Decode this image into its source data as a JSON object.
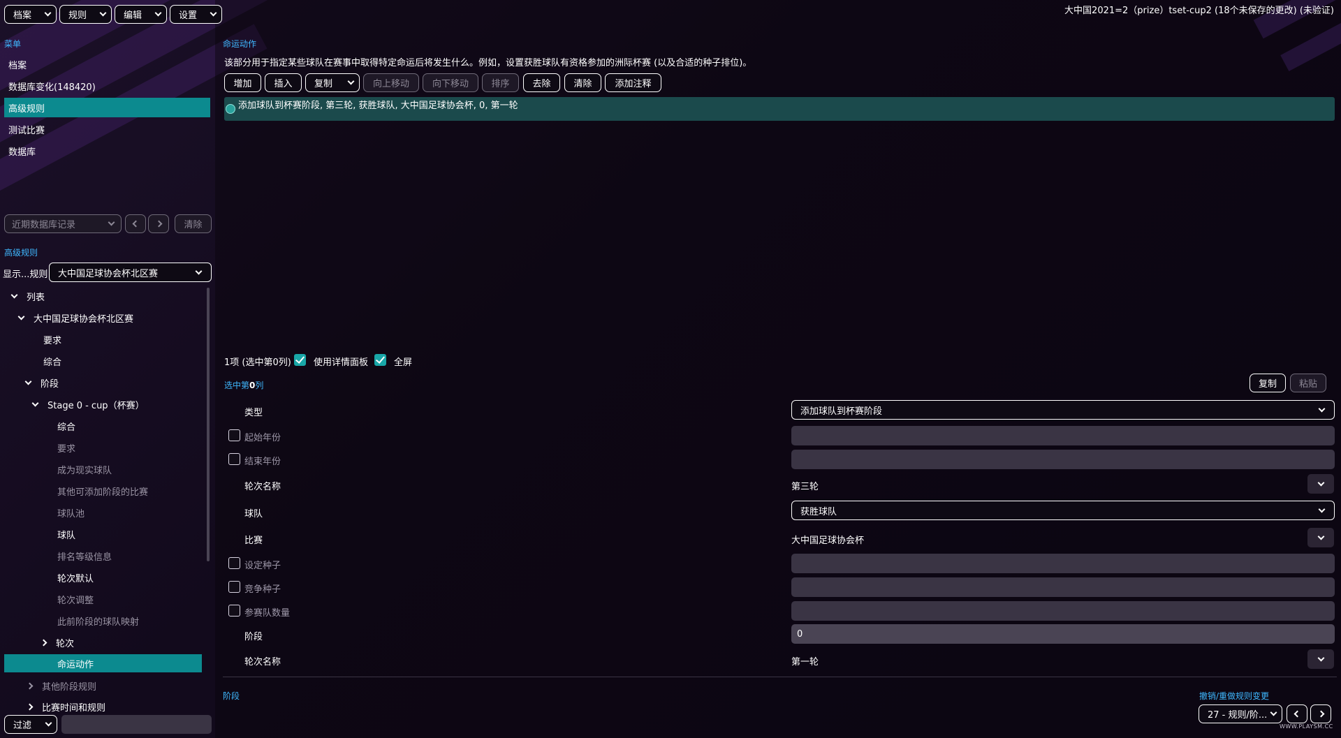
{
  "window_title": "大中国2021=2（prize）tset-cup2 (18个未保存的更改) (未验证)",
  "top_menu": [
    {
      "label": "档案"
    },
    {
      "label": "规则"
    },
    {
      "label": "编辑"
    },
    {
      "label": "设置"
    }
  ],
  "sidebar": {
    "section_title": "菜单",
    "items": [
      {
        "label": "档案"
      },
      {
        "label": "数据库变化(148420)"
      },
      {
        "label": "高级规则"
      },
      {
        "label": "测试比赛"
      },
      {
        "label": "数据库"
      }
    ],
    "history_select": "近期数据库记录",
    "clear_label": "清除"
  },
  "rules_panel": {
    "section_title": "高级规则",
    "show_label": "显示...规则",
    "show_value": "大中国足球协会杯北区赛",
    "tree": [
      {
        "label": "列表"
      },
      {
        "label": "大中国足球协会杯北区赛"
      },
      {
        "label": "要求"
      },
      {
        "label": "综合"
      },
      {
        "label": "阶段"
      },
      {
        "label": "Stage 0 - cup（杯赛）"
      },
      {
        "label": "综合"
      },
      {
        "label": "要求"
      },
      {
        "label": "成为现实球队"
      },
      {
        "label": "其他可添加阶段的比赛"
      },
      {
        "label": "球队池"
      },
      {
        "label": "球队"
      },
      {
        "label": "排名等级信息"
      },
      {
        "label": "轮次默认"
      },
      {
        "label": "轮次调整"
      },
      {
        "label": "此前阶段的球队映射"
      },
      {
        "label": "轮次"
      },
      {
        "label": "命运动作"
      },
      {
        "label": "其他阶段规则"
      },
      {
        "label": "比赛时间和规则"
      }
    ],
    "filter_label": "过滤"
  },
  "main": {
    "section_title": "命运动作",
    "description": "该部分用于指定某些球队在赛事中取得特定命运后将发生什么。例如，设置获胜球队有资格参加的洲际杯赛 (以及合适的种子排位)。",
    "toolbar": {
      "add": "增加",
      "insert": "插入",
      "copy": "复制",
      "move_up": "向上移动",
      "move_down": "向下移动",
      "sort": "排序",
      "remove": "去除",
      "clear": "清除",
      "add_note": "添加注释"
    },
    "list_item": "添加球队到杯赛阶段, 第三轮, 获胜球队, 大中国足球协会杯, 0, 第一轮",
    "selection_status": "1项 (选中第0列)",
    "use_detail_panel": "使用详情面板",
    "fullscreen": "全屏",
    "detail_title_prefix": "选中第",
    "detail_title_num": "0",
    "detail_title_suffix": "列",
    "copy_label": "复制",
    "paste_label": "粘贴",
    "fields": {
      "type_label": "类型",
      "type_value": "添加球队到杯赛阶段",
      "start_year_label": "起始年份",
      "end_year_label": "结束年份",
      "round_name_label": "轮次名称",
      "round_name_value": "第三轮",
      "team_label": "球队",
      "team_value": "获胜球队",
      "competition_label": "比赛",
      "competition_value": "大中国足球协会杯",
      "set_seed_label": "设定种子",
      "compete_seed_label": "竞争种子",
      "num_teams_label": "参赛队数量",
      "stage_label": "阶段",
      "stage_value": "0",
      "round_name2_label": "轮次名称",
      "round_name2_value": "第一轮"
    },
    "footer_label": "阶段",
    "undo_label": "撤销/重做规则变更",
    "undo_select": "27 - 规则/阶..."
  },
  "watermark": "WWW.PLAYSM.CC",
  "colors": {
    "accent": "#0c8a8f",
    "link": "#3fb8ff",
    "background": "#140c1f"
  }
}
